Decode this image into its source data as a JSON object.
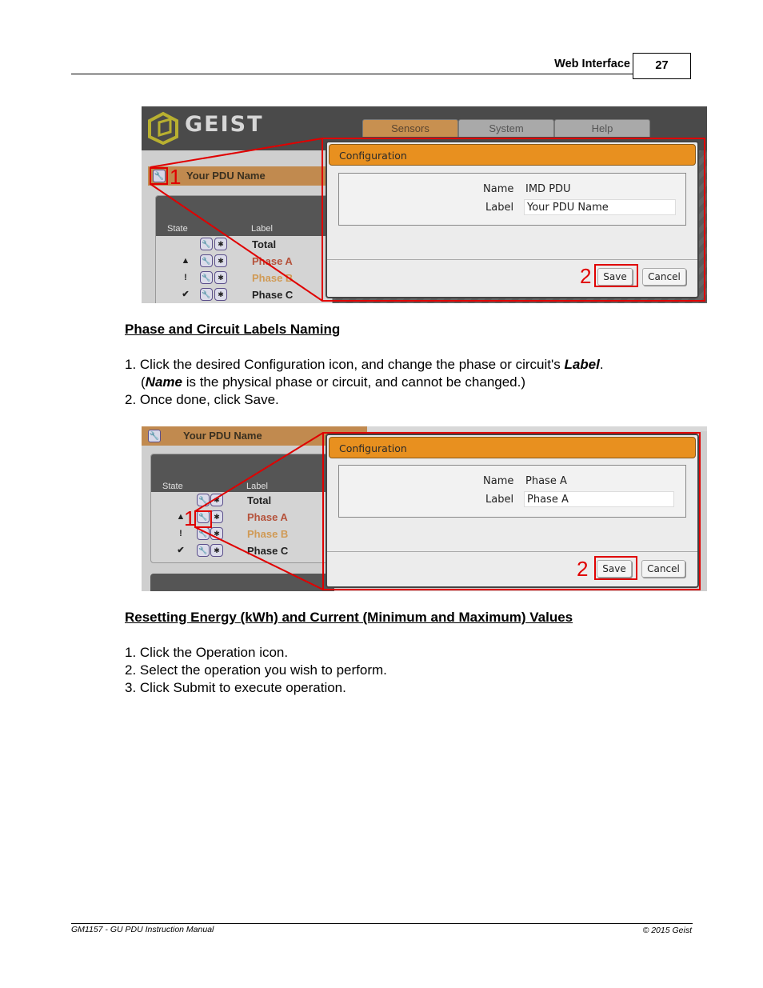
{
  "header": {
    "section_title": "Web Interface",
    "page_number": "27"
  },
  "footer": {
    "left": "GM1157 - GU PDU Instruction Manual",
    "right": "© 2015 Geist"
  },
  "screenshot1": {
    "logo_text": "GEIST",
    "tabs": [
      {
        "label": "Sensors",
        "active": true
      },
      {
        "label": "System",
        "active": false
      },
      {
        "label": "Help",
        "active": false
      }
    ],
    "pdu_name": "Your PDU Name",
    "table_headers": {
      "state": "State",
      "label": "Label"
    },
    "rows": [
      {
        "state_icon": "",
        "label": "Total",
        "color": "#222222"
      },
      {
        "state_icon": "▲",
        "label": "Phase A",
        "color": "#b5523b"
      },
      {
        "state_icon": "!",
        "label": "Phase B",
        "color": "#d09a55"
      },
      {
        "state_icon": "✔",
        "label": "Phase C",
        "color": "#222222"
      }
    ],
    "modal": {
      "title": "Configuration",
      "name_label": "Name",
      "name_value": "IMD PDU",
      "label_label": "Label",
      "label_value": "Your PDU Name",
      "save": "Save",
      "cancel": "Cancel"
    },
    "callouts": [
      "1",
      "2"
    ]
  },
  "section1": {
    "title": "Phase and Circuit Labels Naming",
    "step1_a": "1. Click the desired Configuration icon, and change the phase or circuit's ",
    "step1_bold": "Label",
    "step1_end": ".",
    "step1_paren_open": "(",
    "step1_bold2": "Name",
    "step1_cont": " is the physical phase or circuit, and cannot be changed.)",
    "step2": "2. Once done, click Save."
  },
  "screenshot2": {
    "pdu_name": "Your PDU Name",
    "table_headers": {
      "state": "State",
      "label": "Label"
    },
    "rows": [
      {
        "state_icon": "",
        "label": "Total",
        "color": "#222222"
      },
      {
        "state_icon": "▲",
        "label": "Phase A",
        "color": "#b5523b"
      },
      {
        "state_icon": "!",
        "label": "Phase B",
        "color": "#d09a55"
      },
      {
        "state_icon": "✔",
        "label": "Phase C",
        "color": "#222222"
      }
    ],
    "modal": {
      "title": "Configuration",
      "name_label": "Name",
      "name_value": "Phase A",
      "label_label": "Label",
      "label_value": "Phase A",
      "save": "Save",
      "cancel": "Cancel"
    },
    "callouts": [
      "1",
      "2"
    ]
  },
  "section2": {
    "title": "Resetting Energy (kWh) and Current (Minimum and Maximum) Values",
    "steps": [
      "1. Click the Operation icon.",
      "2. Select the operation you wish to perform.",
      "3. Click Submit to execute operation."
    ]
  }
}
